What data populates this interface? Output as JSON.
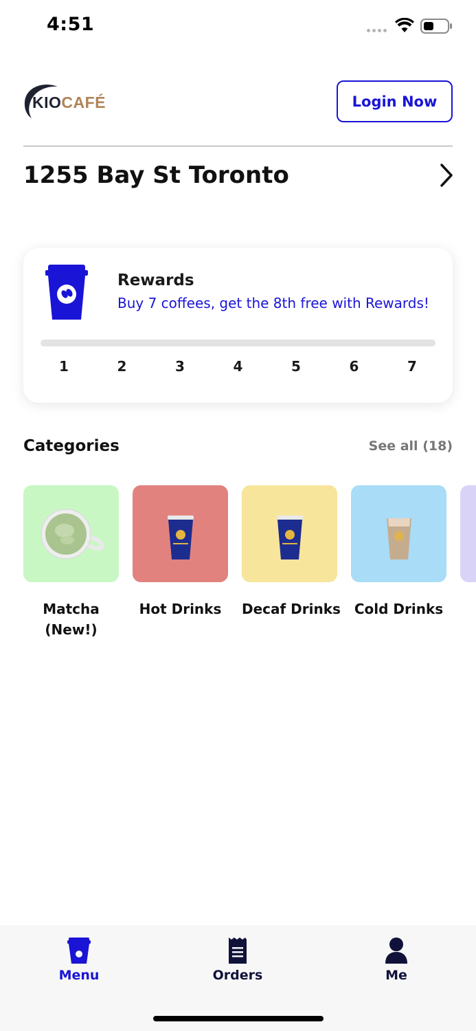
{
  "status_bar": {
    "time": "4:51"
  },
  "header": {
    "logo_part1": "KIO",
    "logo_part2": "CAFÉ",
    "login_label": "Login Now"
  },
  "location": {
    "address": "1255 Bay St Toronto"
  },
  "rewards": {
    "title": "Rewards",
    "subtitle": "Buy 7 coffees, get the 8th free with Rewards!",
    "progress_fraction": 0,
    "steps": [
      "1",
      "2",
      "3",
      "4",
      "5",
      "6",
      "7"
    ]
  },
  "categories": {
    "title": "Categories",
    "see_all": "See all (18)",
    "items": [
      {
        "label_line1": "Matcha",
        "label_line2": "(New!)",
        "color": "#c8f7c4"
      },
      {
        "label_line1": "Hot Drinks",
        "label_line2": "",
        "color": "#e1827f"
      },
      {
        "label_line1": "Decaf Drinks",
        "label_line2": "",
        "color": "#f7e59c"
      },
      {
        "label_line1": "Cold Drinks",
        "label_line2": "",
        "color": "#a9dcf7"
      },
      {
        "label_line1": "",
        "label_line2": "",
        "color": "#d9d4f7"
      }
    ]
  },
  "bottom_nav": {
    "items": [
      {
        "label": "Menu",
        "icon": "cup-icon",
        "active": true
      },
      {
        "label": "Orders",
        "icon": "receipt-icon",
        "active": false
      },
      {
        "label": "Me",
        "icon": "person-icon",
        "active": false
      }
    ]
  },
  "colors": {
    "accent": "#1a14d6",
    "nav_inactive": "#10123a",
    "logo_gold": "#b08356"
  }
}
